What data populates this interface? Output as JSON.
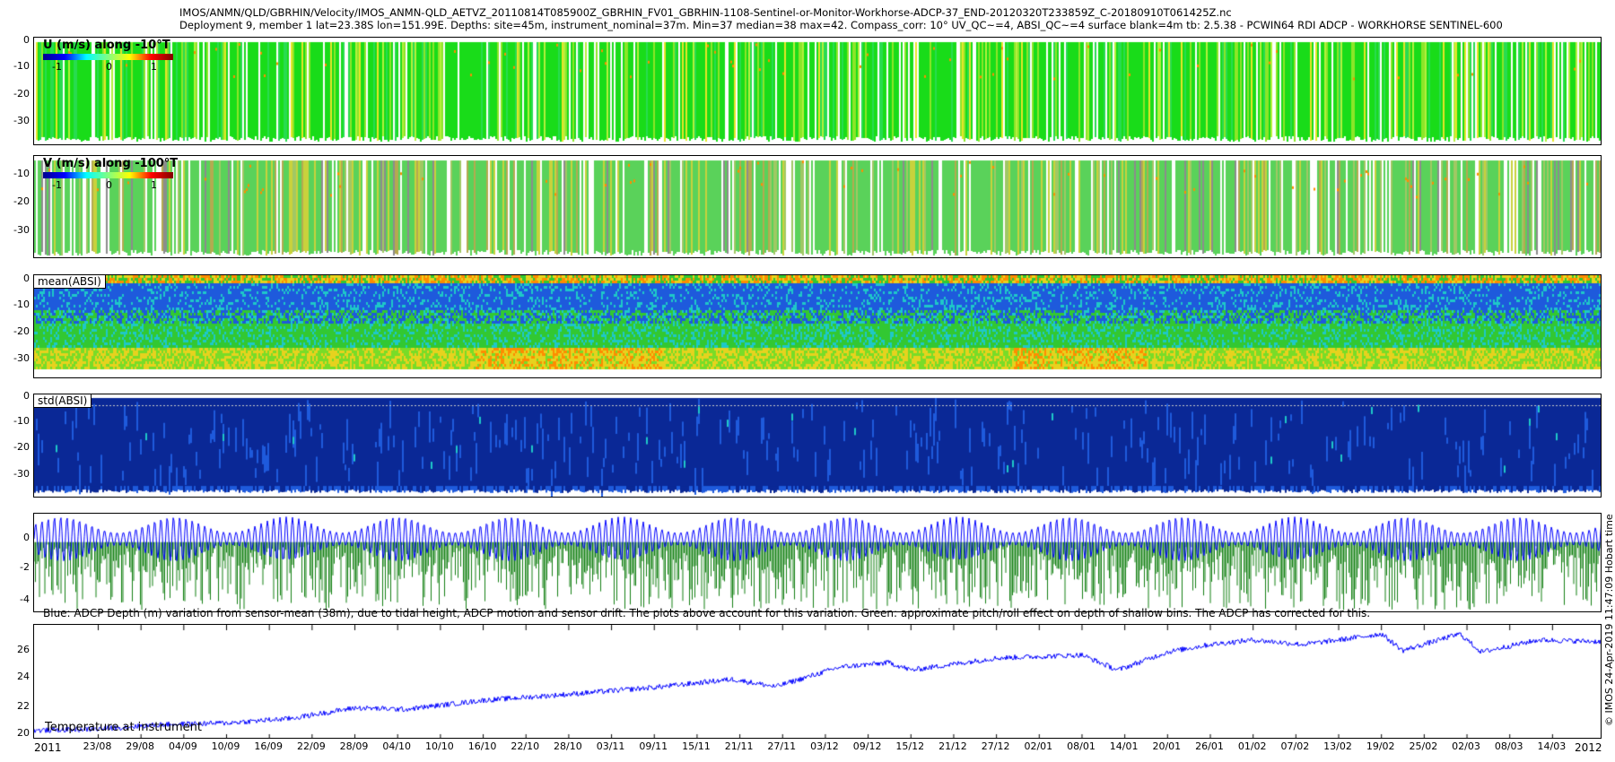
{
  "header": {
    "line1": "IMOS/ANMN/QLD/GBRHIN/Velocity/IMOS_ANMN-QLD_AETVZ_20110814T085900Z_GBRHIN_FV01_GBRHIN-1108-Sentinel-or-Monitor-Workhorse-ADCP-37_END-20120320T233859Z_C-20180910T061425Z.nc",
    "line2": "Deployment 9, member 1 lat=23.38S lon=151.99E. Depths: site=45m, instrument_nominal=37m. Min=37 median=38 max=42. Compass_corr: 10° UV_QC~=4, ABSI_QC~=4 surface blank=4m tb: 2.5.38 - PCWIN64 RDI ADCP - WORKHORSE SENTINEL-600"
  },
  "side_text": "© IMOS 24-Apr-2019 11:47:09 Hobart time",
  "chart_data": [
    {
      "type": "heatmap",
      "label": "U (m/s) along -10°T",
      "colorbar": {
        "ticks": [
          "-1",
          "0",
          "1"
        ],
        "range": [
          -1,
          1
        ]
      },
      "ylim": [
        -38,
        0
      ],
      "yticks": [
        "0",
        "-10",
        "-20",
        "-30"
      ],
      "dominant_value": 0.2,
      "color": "#19dc19"
    },
    {
      "type": "heatmap",
      "label": "V (m/s) along -100°T",
      "colorbar": {
        "ticks": [
          "-1",
          "0",
          "1"
        ],
        "range": [
          -1,
          1
        ]
      },
      "ylim": [
        -38,
        0
      ],
      "yticks": [
        "-10",
        "-20",
        "-30"
      ],
      "dominant_value": 0.2,
      "color": "#5ad25a"
    },
    {
      "type": "heatmap",
      "label": "mean(ABSI)",
      "ylim": [
        -38,
        0
      ],
      "yticks": [
        "0",
        "-10",
        "-20",
        "-30"
      ],
      "colors": [
        "#1e5adc",
        "#1ec8c8",
        "#32c832",
        "#e6d21e",
        "#ff8c00"
      ]
    },
    {
      "type": "heatmap",
      "label": "std(ABSI)",
      "ylim": [
        -38,
        0
      ],
      "yticks": [
        "0",
        "-10",
        "-20",
        "-30"
      ],
      "colors": [
        "#0a2896",
        "#1e5adc"
      ]
    },
    {
      "type": "line",
      "ylim": [
        -4.5,
        1.8
      ],
      "yticks": [
        "0",
        "-2",
        "-4"
      ],
      "note": "Blue: ADCP Depth (m) variation from sensor-mean (38m), due to tidal height, ADCP motion and sensor drift. The plots above account for this variation. Green: approximate pitch/roll effect on depth of shallow bins. The ADCP has corrected for this.",
      "series": [
        {
          "color": "#0000ff",
          "amplitude": [
            0.5,
            1.5
          ]
        },
        {
          "color": "#138013",
          "peak_depths": [
            -1.8,
            -4.3
          ]
        }
      ]
    },
    {
      "type": "line",
      "label": "Temperature at instrument",
      "ylim": [
        20,
        27.6
      ],
      "yticks": [
        "26",
        "24",
        "22",
        "20"
      ],
      "series": [
        {
          "color": "#0000ff",
          "x": [
            "2011-08-14",
            "2011-08-23",
            "2011-09-01",
            "2011-09-10",
            "2011-09-19",
            "2011-09-28",
            "2011-10-05",
            "2011-10-16",
            "2011-10-28",
            "2011-11-10",
            "2011-11-20",
            "2011-11-26",
            "2011-12-05",
            "2011-12-12",
            "2011-12-15",
            "2011-12-27",
            "2012-01-08",
            "2012-01-13",
            "2012-01-20",
            "2012-01-26",
            "2012-02-01",
            "2012-02-08",
            "2012-02-13",
            "2012-02-19",
            "2012-02-22",
            "2012-03-01",
            "2012-03-04",
            "2012-03-12",
            "2012-03-20"
          ],
          "values": [
            20.6,
            20.7,
            21.0,
            21.1,
            21.4,
            22.1,
            22.0,
            22.6,
            23.0,
            23.5,
            24.0,
            23.5,
            24.8,
            25.1,
            24.6,
            25.4,
            25.6,
            24.6,
            25.8,
            26.3,
            26.6,
            26.3,
            26.6,
            27.0,
            25.9,
            27.0,
            25.8,
            26.6,
            26.5
          ]
        }
      ]
    }
  ],
  "x_axis": {
    "start": "2011-08-14",
    "end": "2012-03-21",
    "tick_start": "2011-08-23",
    "tick_step_days": 6,
    "ticks": [
      "23/08",
      "29/08",
      "04/09",
      "10/09",
      "16/09",
      "22/09",
      "28/09",
      "04/10",
      "10/10",
      "16/10",
      "22/10",
      "28/10",
      "03/11",
      "09/11",
      "15/11",
      "21/11",
      "27/11",
      "03/12",
      "09/12",
      "15/12",
      "21/12",
      "27/12",
      "02/01",
      "08/01",
      "14/01",
      "20/01",
      "26/01",
      "01/02",
      "07/02",
      "13/02",
      "19/02",
      "25/02",
      "02/03",
      "08/03",
      "14/03"
    ],
    "year_left": "2011",
    "year_right": "2012"
  }
}
